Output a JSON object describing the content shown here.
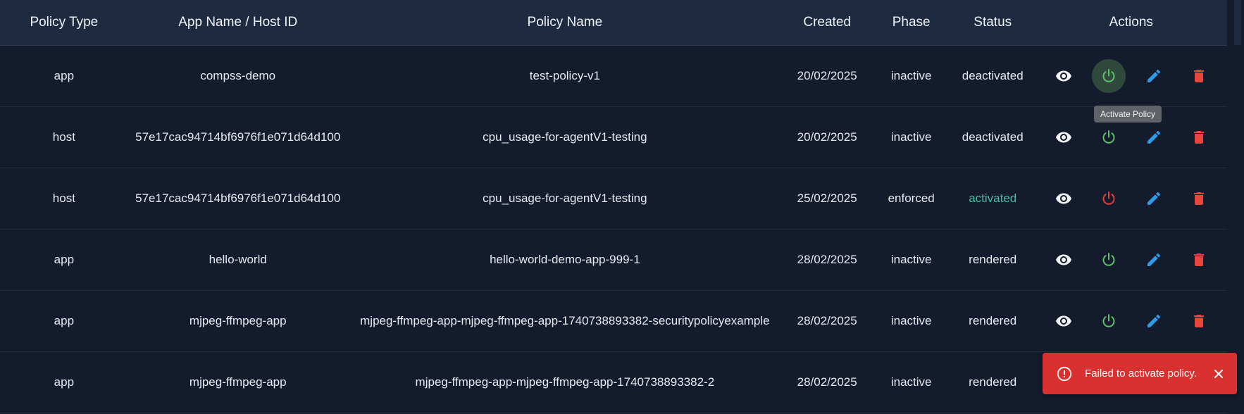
{
  "columns": [
    "Policy Type",
    "App Name / Host ID",
    "Policy Name",
    "Created",
    "Phase",
    "Status",
    "Actions"
  ],
  "rows": [
    {
      "type": "app",
      "app_host": "compss-demo",
      "policy_name": "test-policy-v1",
      "created": "20/02/2025",
      "phase": "inactive",
      "status": "deactivated",
      "power_color": "green"
    },
    {
      "type": "host",
      "app_host": "57e17cac94714bf6976f1e071d64d100",
      "policy_name": "cpu_usage-for-agentV1-testing",
      "created": "20/02/2025",
      "phase": "inactive",
      "status": "deactivated",
      "power_color": "green"
    },
    {
      "type": "host",
      "app_host": "57e17cac94714bf6976f1e071d64d100",
      "policy_name": "cpu_usage-for-agentV1-testing",
      "created": "25/02/2025",
      "phase": "enforced",
      "status": "activated",
      "power_color": "red"
    },
    {
      "type": "app",
      "app_host": "hello-world",
      "policy_name": "hello-world-demo-app-999-1",
      "created": "28/02/2025",
      "phase": "inactive",
      "status": "rendered",
      "power_color": "green"
    },
    {
      "type": "app",
      "app_host": "mjpeg-ffmpeg-app",
      "policy_name": "mjpeg-ffmpeg-app-mjpeg-ffmpeg-app-1740738893382-securitypolicyexample",
      "created": "28/02/2025",
      "phase": "inactive",
      "status": "rendered",
      "power_color": "green"
    },
    {
      "type": "app",
      "app_host": "mjpeg-ffmpeg-app",
      "policy_name": "mjpeg-ffmpeg-app-mjpeg-ffmpeg-app-1740738893382-2",
      "created": "28/02/2025",
      "phase": "inactive",
      "status": "rendered",
      "power_color": "green"
    }
  ],
  "tooltip": {
    "text": "Activate Policy"
  },
  "toast": {
    "message": "Failed to activate policy."
  },
  "icons": {
    "view": "eye-icon",
    "power": "power-icon",
    "edit": "pencil-icon",
    "delete": "trash-icon",
    "error": "error-circle-icon",
    "close": "close-icon"
  },
  "colors": {
    "header_bg": "#1d2a40",
    "page_bg": "#141b2c",
    "activated": "#3dc4a2",
    "power_green": "#5fbf6a",
    "power_red": "#e0413a",
    "edit_blue": "#2d9be8",
    "delete_red": "#e8463c",
    "toast_bg": "#d93030"
  }
}
